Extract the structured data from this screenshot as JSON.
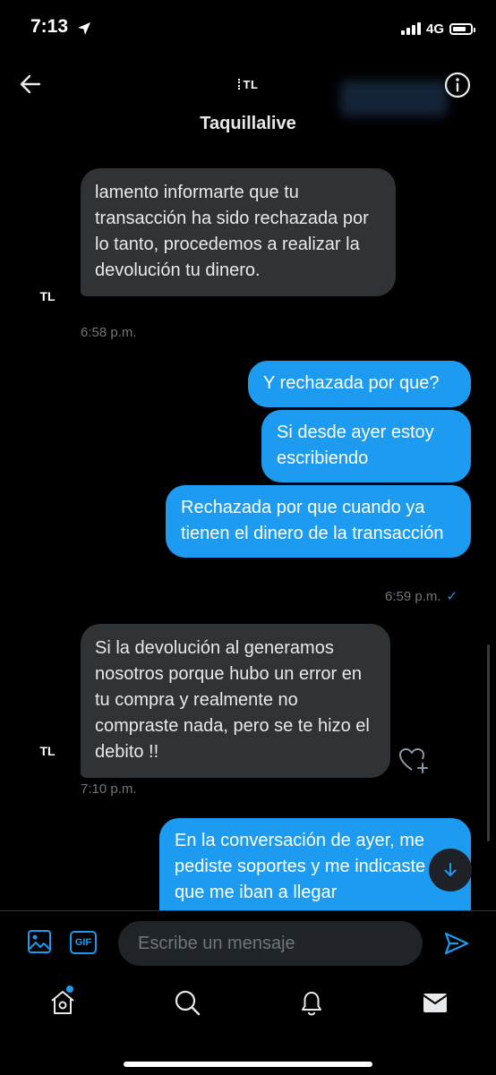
{
  "status_bar": {
    "time": "7:13",
    "network": "4G",
    "battery_level": 0.75
  },
  "header": {
    "logo_text": "TL",
    "title": "Taquillalive"
  },
  "messages": [
    {
      "text": "lamento informarte que tu transacción ha  sido rechazada por lo tanto, procedemos a realizar la devolución  tu dinero.",
      "time": "6:58 p.m."
    },
    {
      "text": "Y rechazada por que?"
    },
    {
      "text": "Si desde ayer estoy escribiendo"
    },
    {
      "text": "Rechazada por que cuando ya tienen el dinero de la transacción",
      "time": "6:59 p.m."
    },
    {
      "text": "Si la devolución al generamos nosotros porque hubo un error en tu compra y realmente no compraste nada, pero se te hizo el debito !!",
      "time": "7:10 p.m."
    },
    {
      "text": "En la conversación de ayer, me pediste soportes y me indicaste que me iban a llegar"
    }
  ],
  "avatar_text": "TL",
  "composer": {
    "placeholder": "Escribe un mensaje",
    "gif_label": "GIF"
  },
  "colors": {
    "accent": "#1d9bf0",
    "incoming_bubble": "#2f3336",
    "background": "#000000"
  },
  "icons": [
    "back-arrow-icon",
    "info-icon",
    "image-icon",
    "gif-icon",
    "send-icon",
    "home-icon",
    "search-icon",
    "bell-icon",
    "mail-icon",
    "heart-plus-icon",
    "arrow-down-icon"
  ]
}
